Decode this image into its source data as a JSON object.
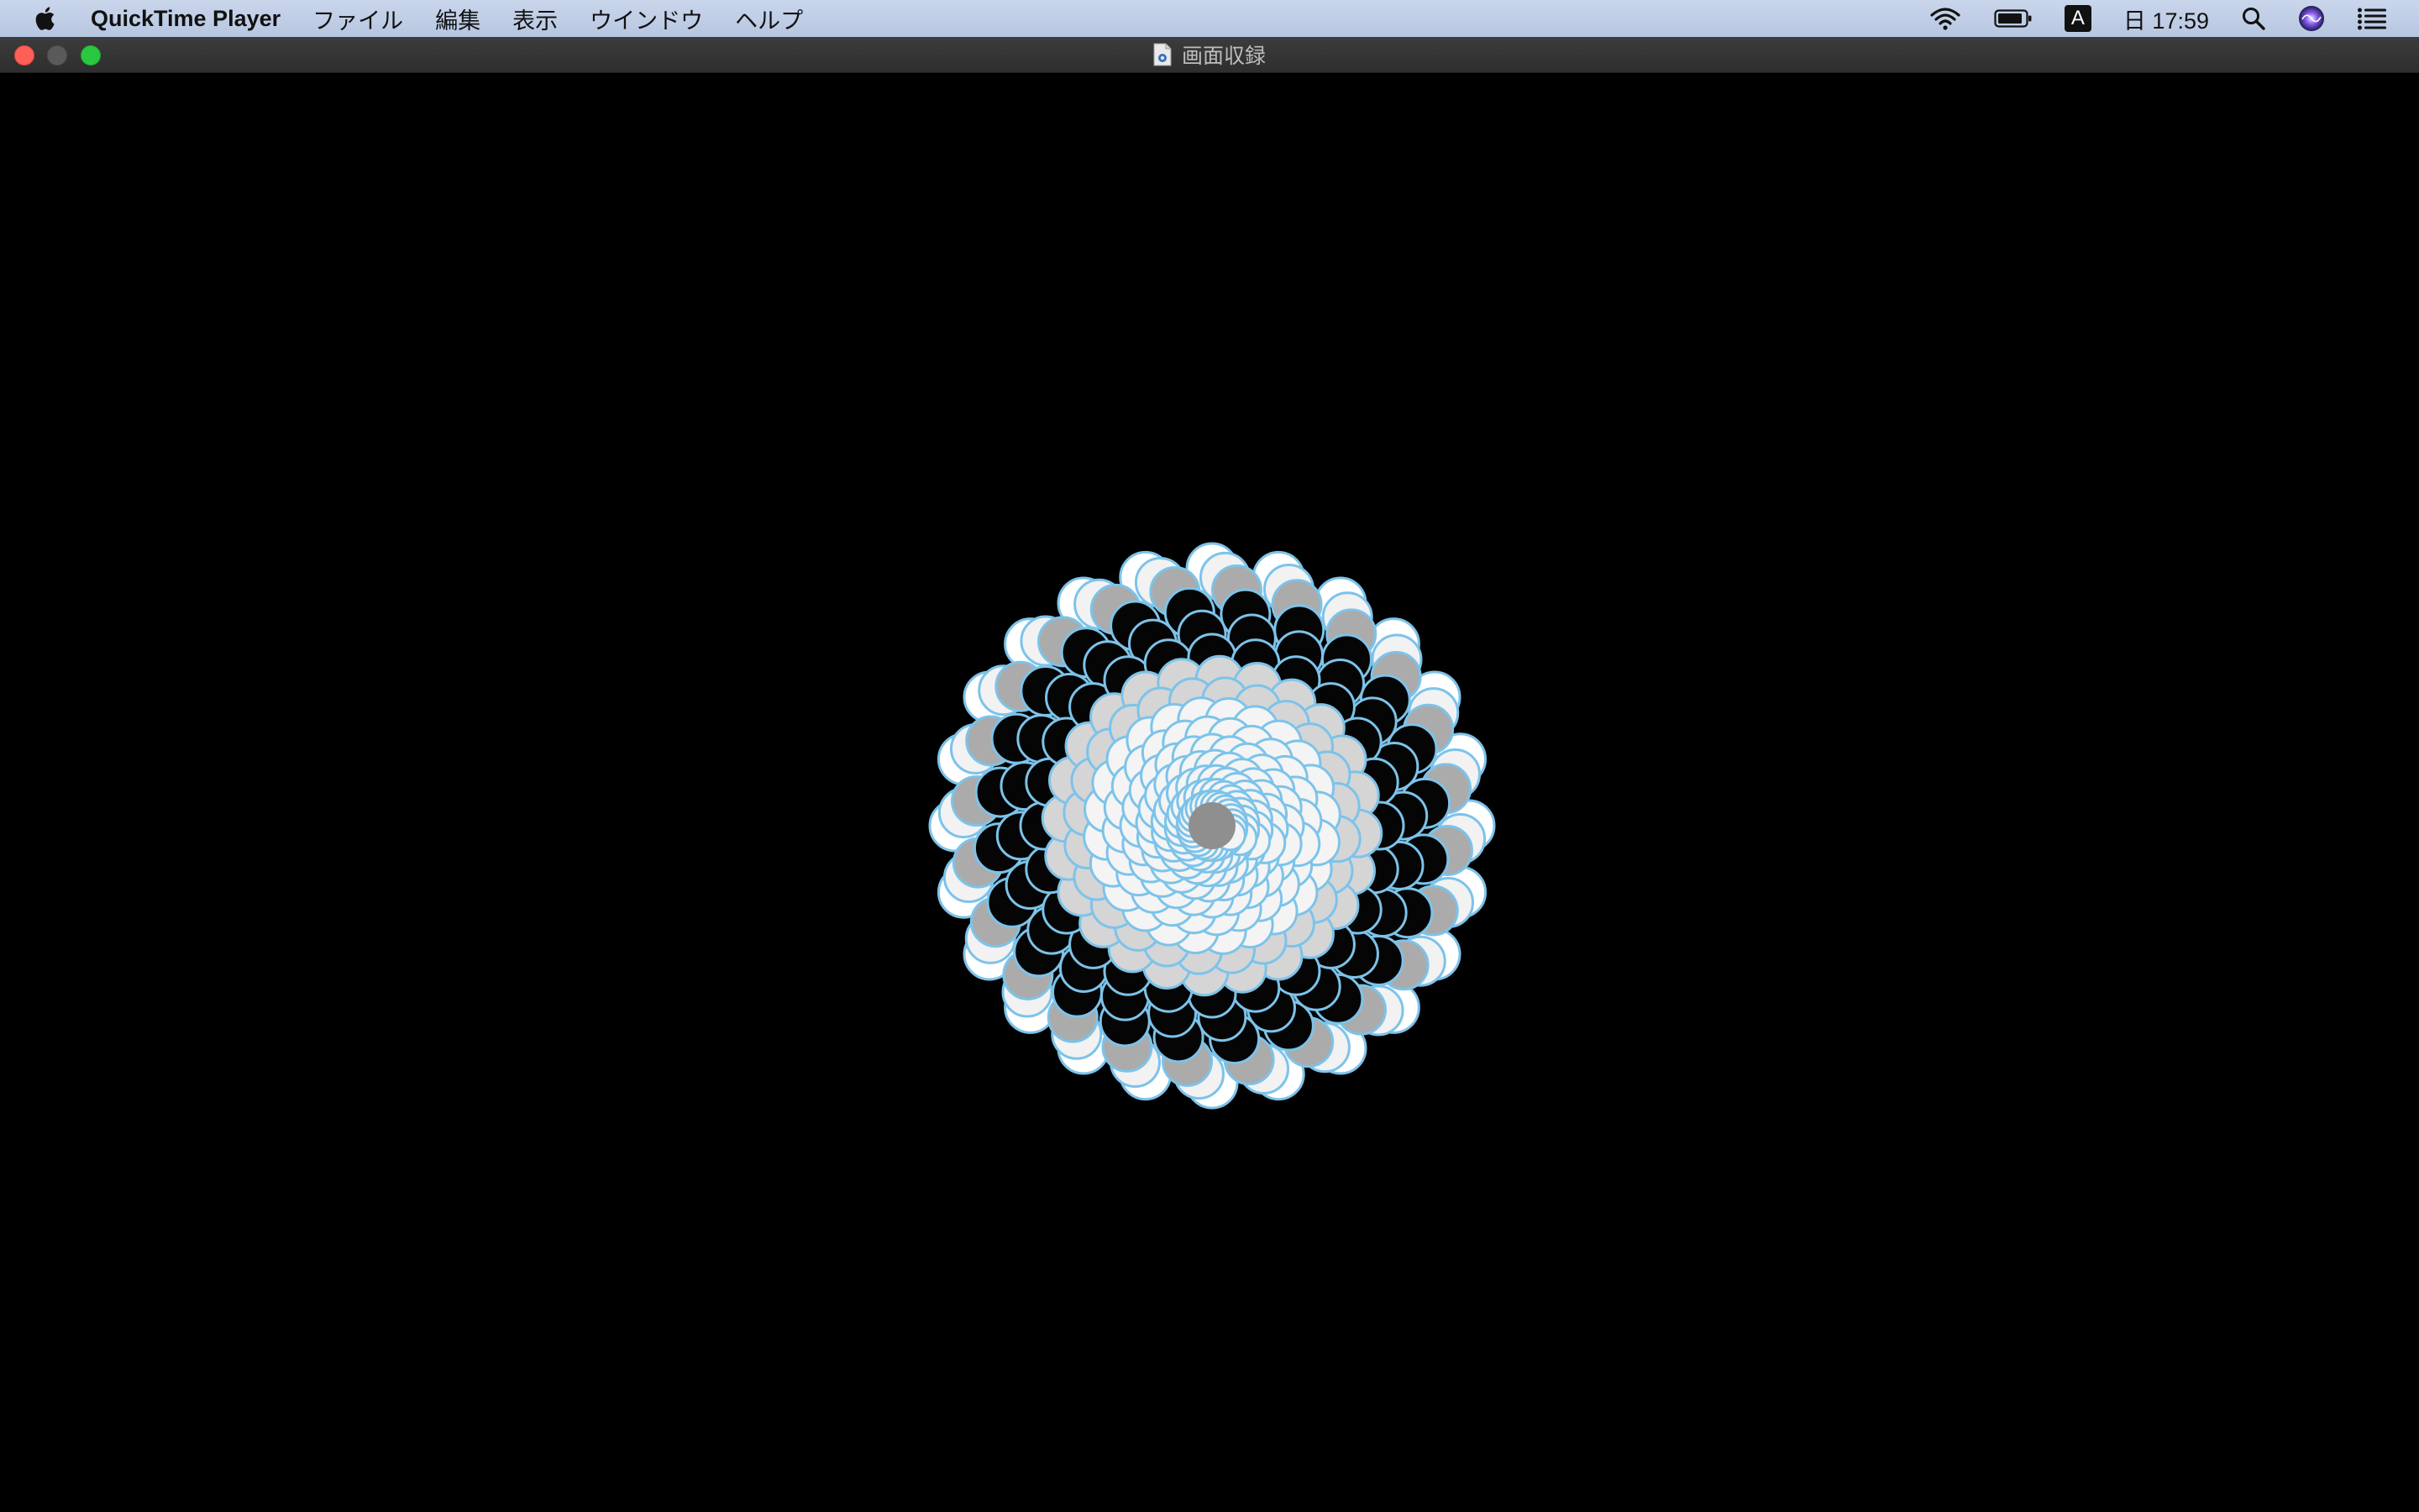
{
  "menubar": {
    "app_name": "QuickTime Player",
    "menus": [
      "ファイル",
      "編集",
      "表示",
      "ウインドウ",
      "ヘルプ"
    ],
    "status": {
      "ime_label": "A",
      "clock": "日 17:59"
    }
  },
  "window": {
    "title": "画面収録"
  },
  "colors": {
    "menubar": "#c0cfe7",
    "titlebar": "#363636",
    "close": "#fe5f57",
    "zoom": "#2ac840",
    "petal_stroke": "#7cc3ea"
  }
}
